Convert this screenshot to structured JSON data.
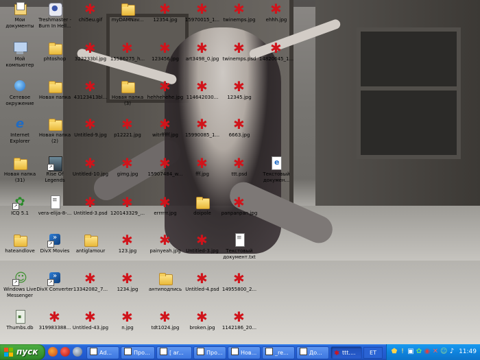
{
  "desktop": {
    "icons": [
      {
        "label": "Мои\nдокументы",
        "type": "mydocs"
      },
      {
        "label": "Treshmaster -\nBurn In Hell...",
        "type": "media"
      },
      {
        "label": "chi5eu.gif",
        "type": "splat"
      },
      {
        "label": "myDAMNav...",
        "type": "folder"
      },
      {
        "label": "12354.jpg",
        "type": "splat"
      },
      {
        "label": "15970015_1...",
        "type": "splat"
      },
      {
        "label": "twinemps.jpg",
        "type": "splat"
      },
      {
        "label": "ehhh.jpg",
        "type": "splat"
      },
      {
        "label": "Мой\nкомпьютер",
        "type": "computer"
      },
      {
        "label": "phtoshop",
        "type": "folder"
      },
      {
        "label": "322233bl.jpg",
        "type": "splat"
      },
      {
        "label": "15586275_h...",
        "type": "splat"
      },
      {
        "label": "123456.jpg",
        "type": "splat"
      },
      {
        "label": "art3498_0.jpg",
        "type": "splat"
      },
      {
        "label": "twinemps.psd",
        "type": "splat"
      },
      {
        "label": "14820645_1...",
        "type": "splat"
      },
      {
        "label": "Сетевое\nокружение",
        "type": "network"
      },
      {
        "label": "Новая папка",
        "type": "folder"
      },
      {
        "label": "43123413bl...",
        "type": "splat"
      },
      {
        "label": "Новая папка\n(3)",
        "type": "folder"
      },
      {
        "label": "hehhehehe.jpg",
        "type": "splat"
      },
      {
        "label": "114642030...",
        "type": "splat"
      },
      {
        "label": "12345.jpg",
        "type": "splat"
      },
      {
        "label": "Internet\nExplorer",
        "type": "ie"
      },
      {
        "label": "Новая папка\n(2)",
        "type": "folder"
      },
      {
        "label": "Untitled-9.jpg",
        "type": "splat"
      },
      {
        "label": "p12221.jpg",
        "type": "splat"
      },
      {
        "label": "witrfffff.jpg",
        "type": "splat"
      },
      {
        "label": "15990085_1...",
        "type": "splat"
      },
      {
        "label": "6663.jpg",
        "type": "splat"
      },
      {
        "label": "Новая папка\n(31)",
        "type": "folder"
      },
      {
        "label": "Rise Of\nLegends",
        "type": "game"
      },
      {
        "label": "Untitled-10.jpg",
        "type": "splat"
      },
      {
        "label": "gimg.jpg",
        "type": "splat"
      },
      {
        "label": "15907484_w...",
        "type": "splat"
      },
      {
        "label": "fff.jpg",
        "type": "splat"
      },
      {
        "label": "ttt.psd",
        "type": "splat"
      },
      {
        "label": "Текстовый\nдокумен...",
        "type": "txtdoc"
      },
      {
        "label": "ICQ 5.1",
        "type": "icq"
      },
      {
        "label": "vera-elija-8-...",
        "type": "txt"
      },
      {
        "label": "Untitled-3.psd",
        "type": "splat"
      },
      {
        "label": "120143329_...",
        "type": "splat"
      },
      {
        "label": "errrrrr.jpg",
        "type": "splat"
      },
      {
        "label": "doipolе",
        "type": "folder"
      },
      {
        "label": "panpanpan.jpg",
        "type": "splat"
      },
      {
        "label": "hateandlove",
        "type": "folder"
      },
      {
        "label": "DivX Movies",
        "type": "divx"
      },
      {
        "label": "antiglamour",
        "type": "folder"
      },
      {
        "label": "123.jpg",
        "type": "splat"
      },
      {
        "label": "painyeah.jpg",
        "type": "splat"
      },
      {
        "label": "Untitled-3.jpg",
        "type": "splat"
      },
      {
        "label": "Текстовый\nдокумент.txt",
        "type": "txt"
      },
      {
        "label": "Windows Live\nMessenger",
        "type": "messenger"
      },
      {
        "label": "DivX Converter",
        "type": "divx"
      },
      {
        "label": "13342082_7...",
        "type": "splat"
      },
      {
        "label": "1234.jpg",
        "type": "splat"
      },
      {
        "label": "антиподпись",
        "type": "folder"
      },
      {
        "label": "Untitled-4.psd",
        "type": "splat"
      },
      {
        "label": "14955800_2...",
        "type": "splat"
      },
      {
        "label": "Thumbs.db",
        "type": "db"
      },
      {
        "label": "319983388...",
        "type": "splat"
      },
      {
        "label": "Untitled-43.jpg",
        "type": "splat"
      },
      {
        "label": "n.jpg",
        "type": "splat"
      },
      {
        "label": "tdt1024.jpg",
        "type": "splat"
      },
      {
        "label": "broken.jpg",
        "type": "splat"
      },
      {
        "label": "1142186_20...",
        "type": "splat"
      }
    ]
  },
  "taskbar": {
    "start_label": "пуск",
    "quick_launch": [
      "firefox-icon",
      "opera-icon",
      "media-icon"
    ],
    "tasks": [
      {
        "label": "Ad...",
        "icon": "window",
        "active": false
      },
      {
        "label": "Про...",
        "icon": "window",
        "active": false
      },
      {
        "label": "[ ar...",
        "icon": "window",
        "active": false
      },
      {
        "label": "Про...",
        "icon": "window",
        "active": false
      },
      {
        "label": "Нов...",
        "icon": "window",
        "active": false
      },
      {
        "label": "_re...",
        "icon": "window",
        "active": false
      },
      {
        "label": "До...",
        "icon": "window",
        "active": false
      },
      {
        "label": "ttt....",
        "icon": "splat",
        "active": true
      }
    ],
    "language": "ET",
    "clock": "11:49",
    "tray_icons": [
      "shield-icon",
      "alert-icon",
      "network-icon",
      "icq-icon",
      "volume-icon",
      "antivirus-icon",
      "cross-icon",
      "chat-icon",
      "update-icon",
      "speaker-icon"
    ]
  },
  "colors": {
    "taskbar_blue": "#245ed3",
    "start_green": "#3c9a34",
    "tray_blue": "#0f83dd",
    "splat_red": "#d0141b"
  }
}
